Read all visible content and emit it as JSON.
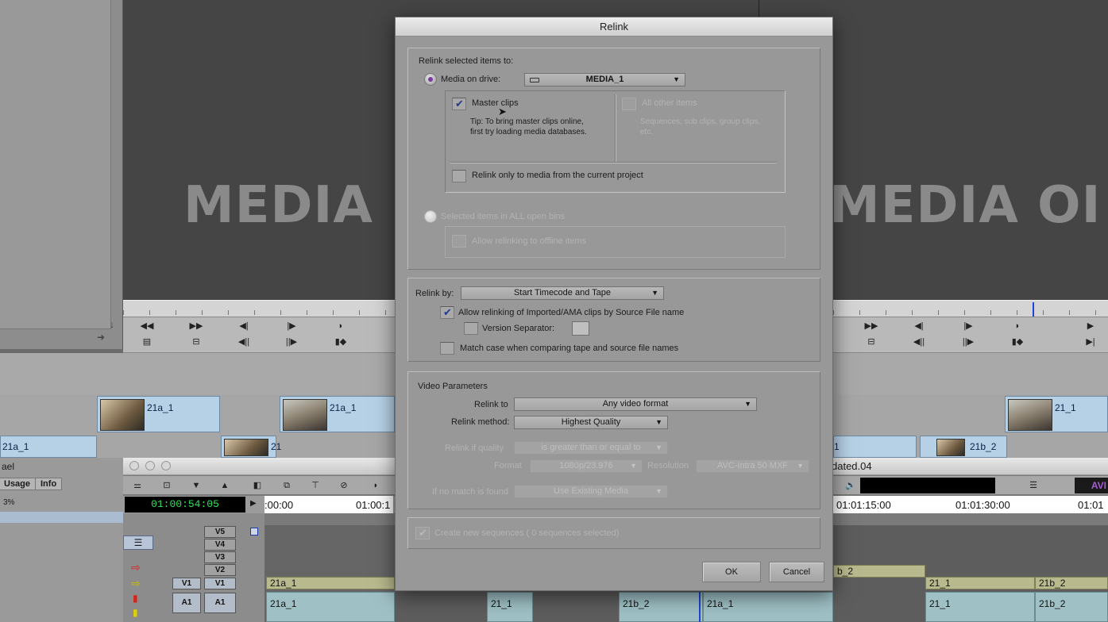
{
  "background": {
    "monitor_overlay_left": "MEDIA",
    "monitor_overlay_right": "MEDIA OI",
    "clips_upper": [
      "21a_1",
      "21a_1",
      "21_1"
    ],
    "clips_lower": [
      "21a_1",
      "21",
      "1",
      "21b_2"
    ],
    "bin_tabs": [
      "Usage",
      "Info"
    ],
    "bin_partial_title": "ael",
    "bin_percent": "3%",
    "sequence_partial_name": "dated.04",
    "timecode": "01:00:54:05",
    "ruler_marks": [
      ":00:00",
      "01:00:1",
      "01:01:15:00",
      "01:01:30:00",
      "01:01"
    ],
    "tracks": [
      "V5",
      "V4",
      "V3",
      "V2",
      "V1",
      "A1"
    ],
    "source_tracks": [
      "V1",
      "A1"
    ],
    "timeline_segments": {
      "v1": [
        "21a_1",
        "b_2",
        "21_1",
        "21b_2"
      ],
      "a1": [
        "21a_1",
        "21_1",
        "21b_2",
        "21a_1",
        "21_1",
        "21b_2"
      ]
    }
  },
  "dialog": {
    "title": "Relink",
    "section_relink_to": {
      "heading": "Relink selected items to:",
      "media_on_drive_label": "Media on drive:",
      "drive_value": "MEDIA_1",
      "master_clips_label": "Master clips",
      "master_clips_checked": true,
      "tip": "Tip: To bring master clips online, first try loading media databases.",
      "all_other_items_label": "All other items",
      "all_other_items_desc": "Sequences, sub clips, group clips, etc.",
      "current_project_only_label": "Relink only to media from the current project",
      "selected_items_label": "Selected items in ALL open bins",
      "allow_offline_label": "Allow relinking to offline items"
    },
    "section_relink_by": {
      "label": "Relink by:",
      "value": "Start Timecode and Tape",
      "allow_ama_label": "Allow relinking of Imported/AMA clips by Source File name",
      "allow_ama_checked": true,
      "version_separator_label": "Version Separator:",
      "match_case_label": "Match case when comparing tape and source file names"
    },
    "section_video": {
      "heading": "Video Parameters",
      "relink_to_label": "Relink to",
      "relink_to_value": "Any video format",
      "method_label": "Relink method:",
      "method_value": "Highest Quality",
      "if_quality_label": "Relink if quality",
      "if_quality_value": "is greater than or equal to",
      "format_label": "Format",
      "format_value": "1080p/23.976",
      "resolution_label": "Resolution",
      "resolution_value": "AVC-Intra 50 MXF",
      "no_match_label": "If no match is found",
      "no_match_value": "Use Existing Media"
    },
    "create_sequences_label": "Create new sequences  ( 0 sequences selected)",
    "ok_label": "OK",
    "cancel_label": "Cancel"
  },
  "colors": {
    "accent_radio": "#7a3aa0",
    "check_mark": "#233c8e",
    "timecode_text": "#2ee25a",
    "clip_blue": "#b6d1e6"
  }
}
